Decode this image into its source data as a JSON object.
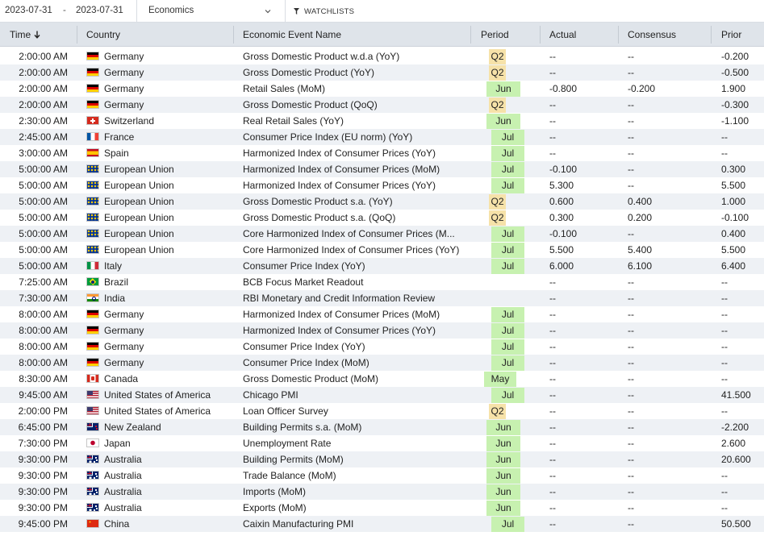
{
  "filters": {
    "date_from": "2023-07-31",
    "date_sep": "-",
    "date_to": "2023-07-31",
    "category": "Economics",
    "watchlists_label": "WATCHLISTS"
  },
  "columns": {
    "time": "Time",
    "country": "Country",
    "event": "Economic Event Name",
    "period": "Period",
    "actual": "Actual",
    "consensus": "Consensus",
    "prior": "Prior"
  },
  "colors": {
    "header_bg": "#dfe4ea",
    "row_alt_bg": "#eef1f5",
    "period_month_bg": "#c7f1b0",
    "period_quarter_bg": "#f6e2a9"
  },
  "rows": [
    {
      "time": "2:00:00 AM",
      "flag": "de",
      "country": "Germany",
      "event": "Gross Domestic Product w.d.a (YoY)",
      "period": "Q2",
      "actual": "--",
      "consensus": "--",
      "prior": "-0.200"
    },
    {
      "time": "2:00:00 AM",
      "flag": "de",
      "country": "Germany",
      "event": "Gross Domestic Product (YoY)",
      "period": "Q2",
      "actual": "--",
      "consensus": "--",
      "prior": "-0.500"
    },
    {
      "time": "2:00:00 AM",
      "flag": "de",
      "country": "Germany",
      "event": "Retail Sales (MoM)",
      "period": "Jun",
      "actual": "-0.800",
      "consensus": "-0.200",
      "prior": "1.900"
    },
    {
      "time": "2:00:00 AM",
      "flag": "de",
      "country": "Germany",
      "event": "Gross Domestic Product (QoQ)",
      "period": "Q2",
      "actual": "--",
      "consensus": "--",
      "prior": "-0.300"
    },
    {
      "time": "2:30:00 AM",
      "flag": "ch",
      "country": "Switzerland",
      "event": "Real Retail Sales (YoY)",
      "period": "Jun",
      "actual": "--",
      "consensus": "--",
      "prior": "-1.100"
    },
    {
      "time": "2:45:00 AM",
      "flag": "fr",
      "country": "France",
      "event": "Consumer Price Index (EU norm) (YoY)",
      "period": "Jul",
      "actual": "--",
      "consensus": "--",
      "prior": "--"
    },
    {
      "time": "3:00:00 AM",
      "flag": "es",
      "country": "Spain",
      "event": "Harmonized Index of Consumer Prices (YoY)",
      "period": "Jul",
      "actual": "--",
      "consensus": "--",
      "prior": "--"
    },
    {
      "time": "5:00:00 AM",
      "flag": "eu",
      "country": "European Union",
      "event": "Harmonized Index of Consumer Prices (MoM)",
      "period": "Jul",
      "actual": "-0.100",
      "consensus": "--",
      "prior": "0.300"
    },
    {
      "time": "5:00:00 AM",
      "flag": "eu",
      "country": "European Union",
      "event": "Harmonized Index of Consumer Prices (YoY)",
      "period": "Jul",
      "actual": "5.300",
      "consensus": "--",
      "prior": "5.500"
    },
    {
      "time": "5:00:00 AM",
      "flag": "eu",
      "country": "European Union",
      "event": "Gross Domestic Product s.a. (YoY)",
      "period": "Q2",
      "actual": "0.600",
      "consensus": "0.400",
      "prior": "1.000"
    },
    {
      "time": "5:00:00 AM",
      "flag": "eu",
      "country": "European Union",
      "event": "Gross Domestic Product s.a. (QoQ)",
      "period": "Q2",
      "actual": "0.300",
      "consensus": "0.200",
      "prior": "-0.100"
    },
    {
      "time": "5:00:00 AM",
      "flag": "eu",
      "country": "European Union",
      "event": "Core Harmonized Index of Consumer Prices (M...",
      "period": "Jul",
      "actual": "-0.100",
      "consensus": "--",
      "prior": "0.400"
    },
    {
      "time": "5:00:00 AM",
      "flag": "eu",
      "country": "European Union",
      "event": "Core Harmonized Index of Consumer Prices (YoY)",
      "period": "Jul",
      "actual": "5.500",
      "consensus": "5.400",
      "prior": "5.500"
    },
    {
      "time": "5:00:00 AM",
      "flag": "it",
      "country": "Italy",
      "event": "Consumer Price Index (YoY)",
      "period": "Jul",
      "actual": "6.000",
      "consensus": "6.100",
      "prior": "6.400"
    },
    {
      "time": "7:25:00 AM",
      "flag": "br",
      "country": "Brazil",
      "event": "BCB Focus Market Readout",
      "period": "",
      "actual": "--",
      "consensus": "--",
      "prior": "--"
    },
    {
      "time": "7:30:00 AM",
      "flag": "in",
      "country": "India",
      "event": "RBI Monetary and Credit Information Review",
      "period": "",
      "actual": "--",
      "consensus": "--",
      "prior": "--"
    },
    {
      "time": "8:00:00 AM",
      "flag": "de",
      "country": "Germany",
      "event": "Harmonized Index of Consumer Prices (MoM)",
      "period": "Jul",
      "actual": "--",
      "consensus": "--",
      "prior": "--"
    },
    {
      "time": "8:00:00 AM",
      "flag": "de",
      "country": "Germany",
      "event": "Harmonized Index of Consumer Prices (YoY)",
      "period": "Jul",
      "actual": "--",
      "consensus": "--",
      "prior": "--"
    },
    {
      "time": "8:00:00 AM",
      "flag": "de",
      "country": "Germany",
      "event": "Consumer Price Index (YoY)",
      "period": "Jul",
      "actual": "--",
      "consensus": "--",
      "prior": "--"
    },
    {
      "time": "8:00:00 AM",
      "flag": "de",
      "country": "Germany",
      "event": "Consumer Price Index (MoM)",
      "period": "Jul",
      "actual": "--",
      "consensus": "--",
      "prior": "--"
    },
    {
      "time": "8:30:00 AM",
      "flag": "ca",
      "country": "Canada",
      "event": "Gross Domestic Product (MoM)",
      "period": "May",
      "actual": "--",
      "consensus": "--",
      "prior": "--"
    },
    {
      "time": "9:45:00 AM",
      "flag": "us",
      "country": "United States of America",
      "event": "Chicago PMI",
      "period": "Jul",
      "actual": "--",
      "consensus": "--",
      "prior": "41.500"
    },
    {
      "time": "2:00:00 PM",
      "flag": "us",
      "country": "United States of America",
      "event": "Loan Officer Survey",
      "period": "Q2",
      "actual": "--",
      "consensus": "--",
      "prior": "--"
    },
    {
      "time": "6:45:00 PM",
      "flag": "nz",
      "country": "New Zealand",
      "event": "Building Permits s.a. (MoM)",
      "period": "Jun",
      "actual": "--",
      "consensus": "--",
      "prior": "-2.200"
    },
    {
      "time": "7:30:00 PM",
      "flag": "jp",
      "country": "Japan",
      "event": "Unemployment Rate",
      "period": "Jun",
      "actual": "--",
      "consensus": "--",
      "prior": "2.600"
    },
    {
      "time": "9:30:00 PM",
      "flag": "au",
      "country": "Australia",
      "event": "Building Permits (MoM)",
      "period": "Jun",
      "actual": "--",
      "consensus": "--",
      "prior": "20.600"
    },
    {
      "time": "9:30:00 PM",
      "flag": "au",
      "country": "Australia",
      "event": "Trade Balance (MoM)",
      "period": "Jun",
      "actual": "--",
      "consensus": "--",
      "prior": "--"
    },
    {
      "time": "9:30:00 PM",
      "flag": "au",
      "country": "Australia",
      "event": "Imports (MoM)",
      "period": "Jun",
      "actual": "--",
      "consensus": "--",
      "prior": "--"
    },
    {
      "time": "9:30:00 PM",
      "flag": "au",
      "country": "Australia",
      "event": "Exports (MoM)",
      "period": "Jun",
      "actual": "--",
      "consensus": "--",
      "prior": "--"
    },
    {
      "time": "9:45:00 PM",
      "flag": "cn",
      "country": "China",
      "event": "Caixin Manufacturing PMI",
      "period": "Jul",
      "actual": "--",
      "consensus": "--",
      "prior": "50.500"
    }
  ]
}
